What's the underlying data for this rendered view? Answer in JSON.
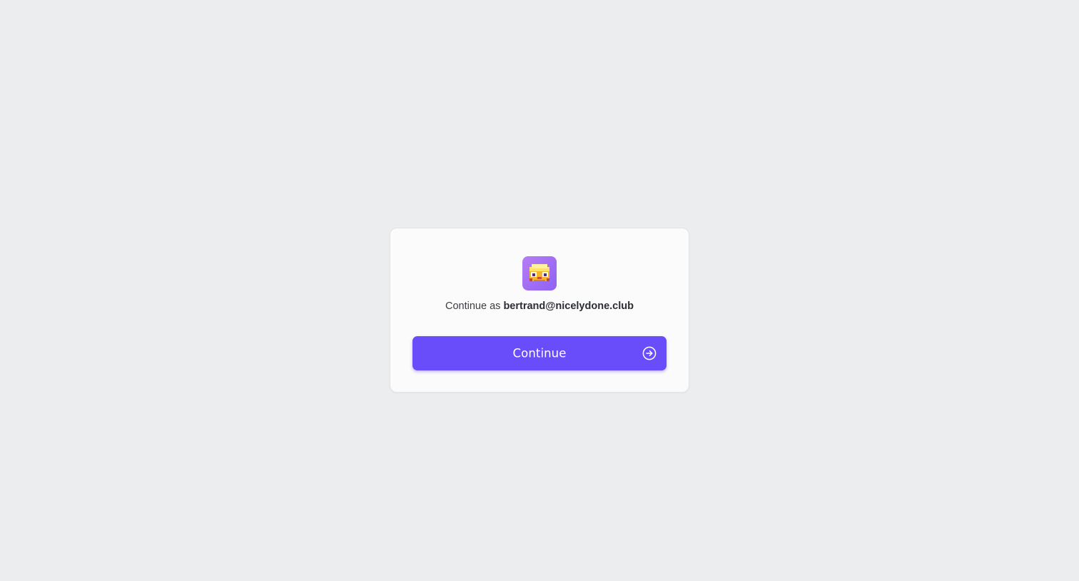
{
  "prompt": {
    "prefix": "Continue as ",
    "email": "bertrand@nicelydone.club"
  },
  "actions": {
    "continue_label": "Continue",
    "continue_icon": "arrow-circle-right-icon"
  },
  "app": {
    "icon": "app-logo-icon"
  },
  "colors": {
    "background": "#ecedef",
    "card": "#fbfbfb",
    "accent": "#6a4dfa",
    "icon_tile": "#9b6cf3"
  }
}
